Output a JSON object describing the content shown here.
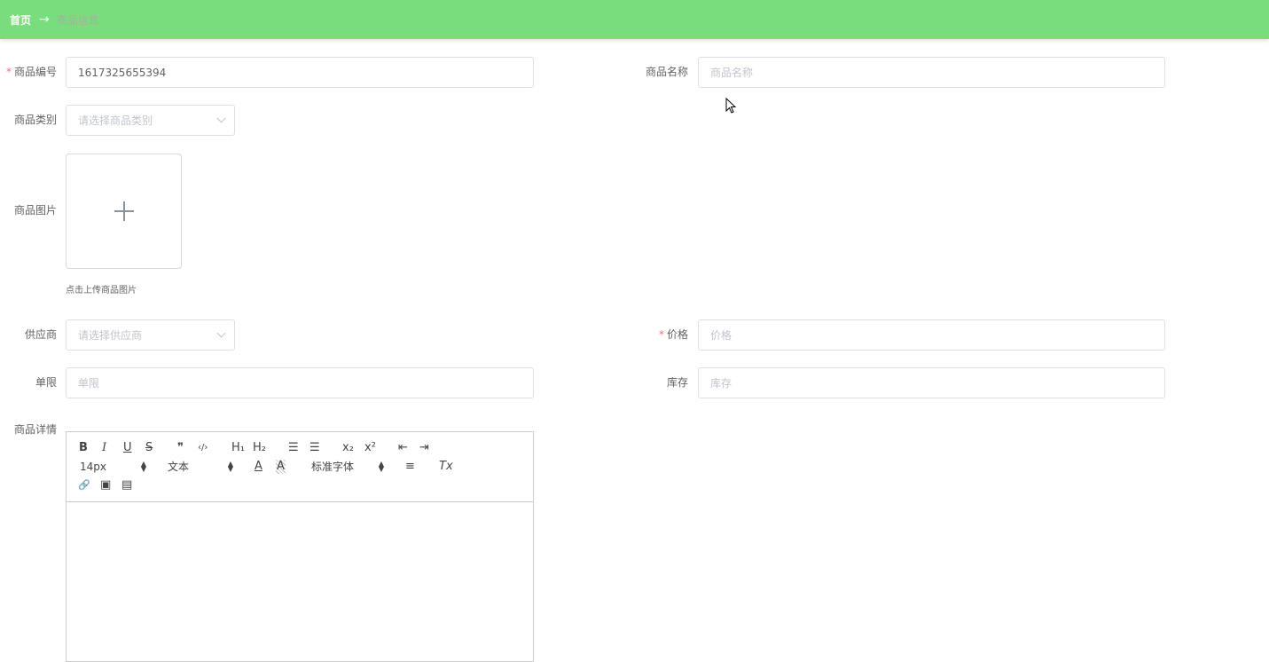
{
  "breadcrumb": {
    "home": "首页",
    "separator": "→",
    "current": "商品信息"
  },
  "form": {
    "code": {
      "label": "商品编号",
      "required": "*",
      "value": "1617325655394"
    },
    "name": {
      "label": "商品名称",
      "placeholder": "商品名称",
      "value": ""
    },
    "category": {
      "label": "商品类别",
      "placeholder": "请选择商品类别"
    },
    "image": {
      "label": "商品图片",
      "tip": "点击上传商品图片"
    },
    "supplier": {
      "label": "供应商",
      "placeholder": "请选择供应商"
    },
    "price": {
      "label": "价格",
      "required": "*",
      "placeholder": "价格"
    },
    "limit": {
      "label": "单限",
      "placeholder": "单限"
    },
    "stock": {
      "label": "库存",
      "placeholder": "库存"
    },
    "detail": {
      "label": "商品详情"
    }
  },
  "editor": {
    "bold": "B",
    "italic": "I",
    "underline": "U",
    "strike": "S",
    "quote": "❞",
    "code": "‹/›",
    "h1": "H₁",
    "h2": "H₂",
    "ordered": "☰",
    "bullet": "☰",
    "sub": "x₂",
    "sup": "x²",
    "outdent": "⇤",
    "indent": "⇥",
    "size": "14px",
    "header": "文本",
    "font": "标准字体",
    "color": "A",
    "background": "A",
    "align": "≡",
    "clean": "Tx",
    "link": "🔗",
    "image": "▣",
    "video": "▤"
  },
  "colors": {
    "topbar": "#79dd7b",
    "required": "#f56c6c",
    "placeholder": "#c0c4cc"
  }
}
